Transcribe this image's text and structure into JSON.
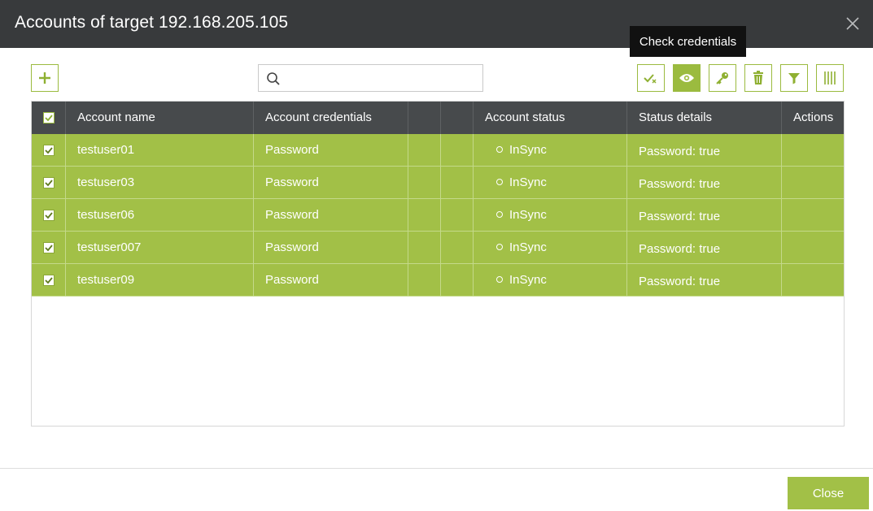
{
  "dialog": {
    "title": "Accounts of target 192.168.205.105"
  },
  "toolbar": {
    "add_icon": "plus-icon",
    "search": {
      "placeholder": "",
      "value": ""
    },
    "tools": [
      {
        "name": "check-all-icon"
      },
      {
        "name": "eye-icon"
      },
      {
        "name": "key-icon"
      },
      {
        "name": "trash-icon"
      },
      {
        "name": "filter-icon"
      },
      {
        "name": "columns-icon"
      }
    ],
    "tooltip": "Check credentials"
  },
  "grid": {
    "columns": {
      "account_name": "Account name",
      "account_credentials": "Account credentials",
      "account_status": "Account status",
      "status_details": "Status details",
      "actions": "Actions"
    },
    "rows": [
      {
        "name": "testuser01",
        "credentials": "Password",
        "status": "InSync",
        "details": "Password: true"
      },
      {
        "name": "testuser03",
        "credentials": "Password",
        "status": "InSync",
        "details": "Password: true"
      },
      {
        "name": "testuser06",
        "credentials": "Password",
        "status": "InSync",
        "details": "Password: true"
      },
      {
        "name": "testuser007",
        "credentials": "Password",
        "status": "InSync",
        "details": "Password: true"
      },
      {
        "name": "testuser09",
        "credentials": "Password",
        "status": "InSync",
        "details": "Password: true"
      }
    ]
  },
  "footer": {
    "close_label": "Close"
  },
  "colors": {
    "accent": "#a2c047",
    "title_bar": "#383a3c",
    "header": "#474a4c"
  }
}
